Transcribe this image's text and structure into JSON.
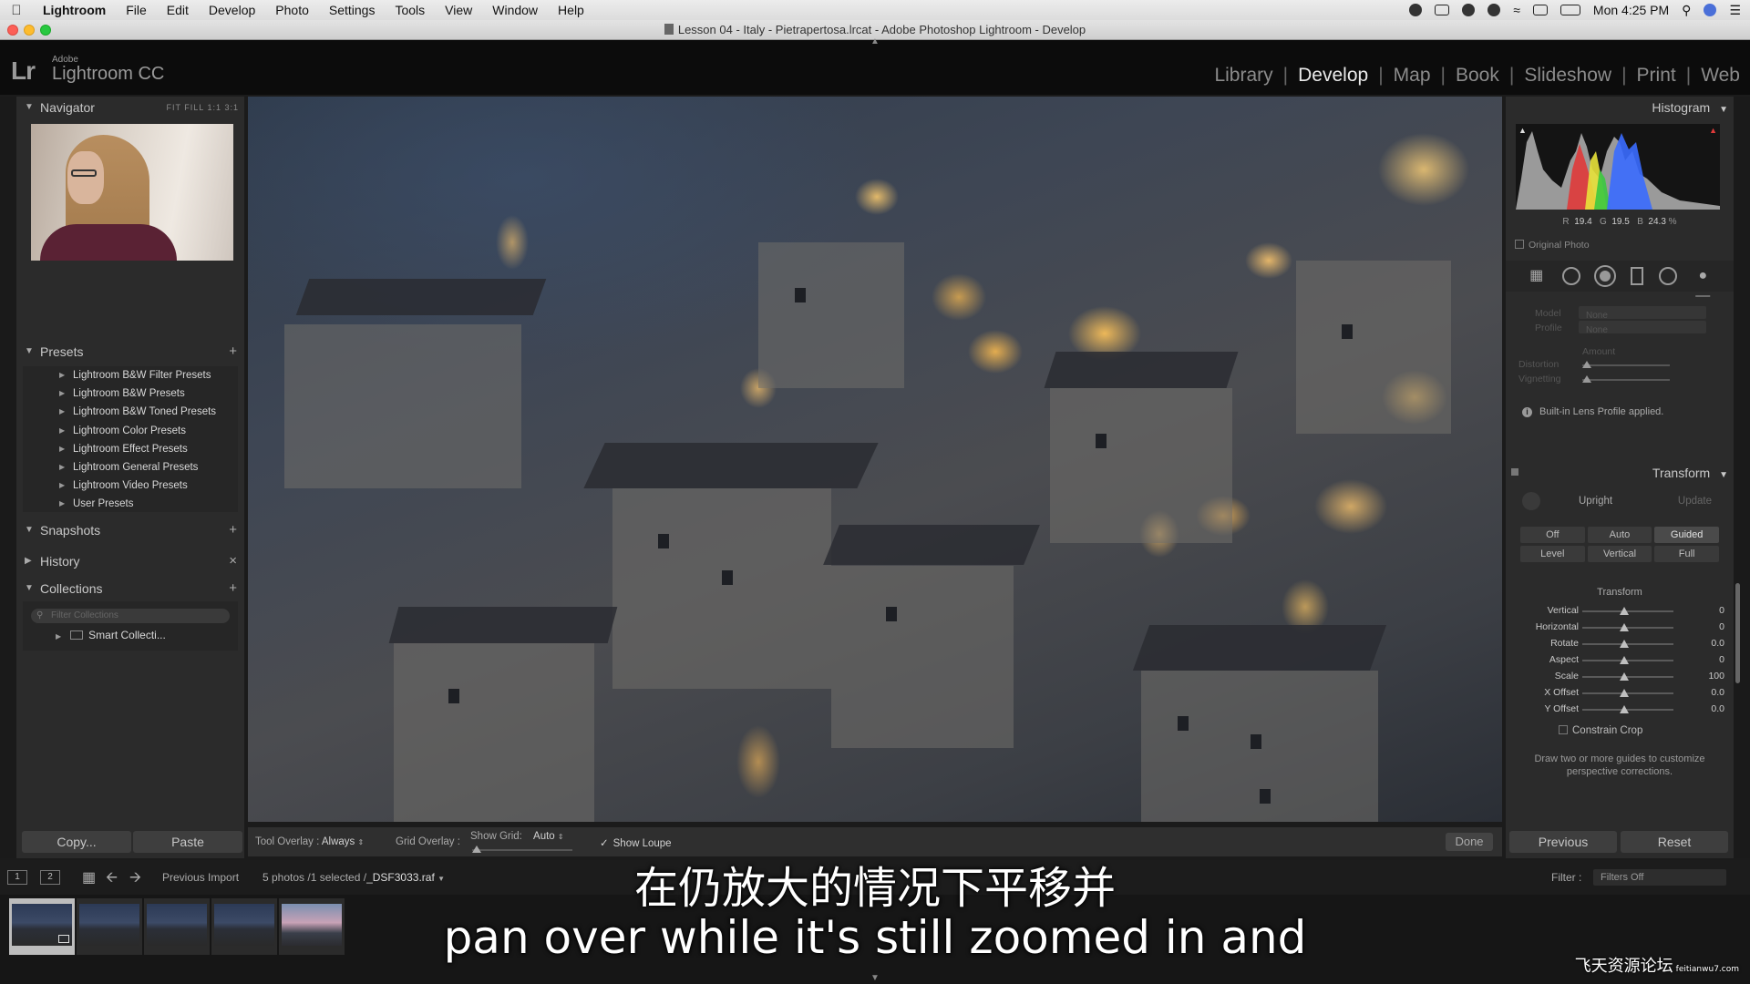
{
  "menubar": {
    "app_name": "Lightroom",
    "items": [
      "File",
      "Edit",
      "Develop",
      "Photo",
      "Settings",
      "Tools",
      "View",
      "Window",
      "Help"
    ],
    "clock": "Mon 4:25 PM"
  },
  "window": {
    "title": "Lesson 04 - Italy - Pietrapertosa.lrcat - Adobe Photoshop Lightroom - Develop"
  },
  "identity": {
    "logo": "Lr",
    "brand_small": "Adobe",
    "brand": "Lightroom CC"
  },
  "modules": [
    "Library",
    "Develop",
    "Map",
    "Book",
    "Slideshow",
    "Print",
    "Web"
  ],
  "active_module": "Develop",
  "left_panel": {
    "navigator": {
      "title": "Navigator",
      "modes": "FIT  FILL  1:1  3:1"
    },
    "presets": {
      "title": "Presets",
      "items": [
        "Lightroom B&W Filter Presets",
        "Lightroom B&W Presets",
        "Lightroom B&W Toned Presets",
        "Lightroom Color Presets",
        "Lightroom Effect Presets",
        "Lightroom General Presets",
        "Lightroom Video Presets",
        "User Presets"
      ]
    },
    "snapshots": {
      "title": "Snapshots"
    },
    "history": {
      "title": "History"
    },
    "collections": {
      "title": "Collections",
      "filter_placeholder": "Filter Collections",
      "smart_collection": "Smart Collecti..."
    },
    "copy_label": "Copy...",
    "paste_label": "Paste"
  },
  "right_panel": {
    "histogram": {
      "title": "Histogram",
      "r_label": "R",
      "r_value": "19.4",
      "g_label": "G",
      "g_value": "19.5",
      "b_label": "B",
      "b_value": "24.3",
      "percent": "%",
      "original_photo": "Original Photo"
    },
    "lens": {
      "model_label": "Model",
      "model_value": "None",
      "profile_label": "Profile",
      "profile_value": "None",
      "amount_label": "Amount",
      "distortion_label": "Distortion",
      "vignetting_label": "Vignetting",
      "info": "Built-in Lens Profile applied."
    },
    "transform": {
      "title": "Transform",
      "upright_label": "Upright",
      "update_label": "Update",
      "upright_buttons": [
        "Off",
        "Auto",
        "Guided",
        "Level",
        "Vertical",
        "Full"
      ],
      "active_button": "Guided",
      "sub_title": "Transform",
      "sliders": [
        {
          "label": "Vertical",
          "value": "0"
        },
        {
          "label": "Horizontal",
          "value": "0"
        },
        {
          "label": "Rotate",
          "value": "0.0"
        },
        {
          "label": "Aspect",
          "value": "0"
        },
        {
          "label": "Scale",
          "value": "100"
        },
        {
          "label": "X Offset",
          "value": "0.0"
        },
        {
          "label": "Y Offset",
          "value": "0.0"
        }
      ],
      "constrain_crop": "Constrain Crop",
      "guide_note": "Draw two or more guides to customize perspective corrections."
    },
    "previous_label": "Previous",
    "reset_label": "Reset"
  },
  "toolbar": {
    "tool_overlay_label": "Tool Overlay :",
    "tool_overlay_value": "Always",
    "grid_overlay_label": "Grid Overlay :",
    "show_grid_label": "Show Grid:",
    "show_grid_value": "Auto",
    "show_loupe_label": "Show Loupe",
    "done_label": "Done"
  },
  "filmbar": {
    "monitor_1": "1",
    "monitor_2": "2",
    "source": "Previous Import",
    "count": "5 photos /1 selected /",
    "filename": "_DSF3033.raf",
    "filter_label": "Filter :",
    "filter_value": "Filters Off"
  },
  "subtitles": {
    "chinese": "在仍放大的情况下平移并",
    "english": "pan over while it's still zoomed in and"
  },
  "watermark": {
    "text": "飞天资源论坛",
    "url": "feitianwu7.com"
  },
  "colors": {
    "accent_active_module": "#eaeaea",
    "panel_bg": "#2b2b2b",
    "histogram_red": "#e03a3a",
    "histogram_green": "#3cc840",
    "histogram_blue": "#3a6cff",
    "histogram_yellow": "#e8e23a"
  }
}
